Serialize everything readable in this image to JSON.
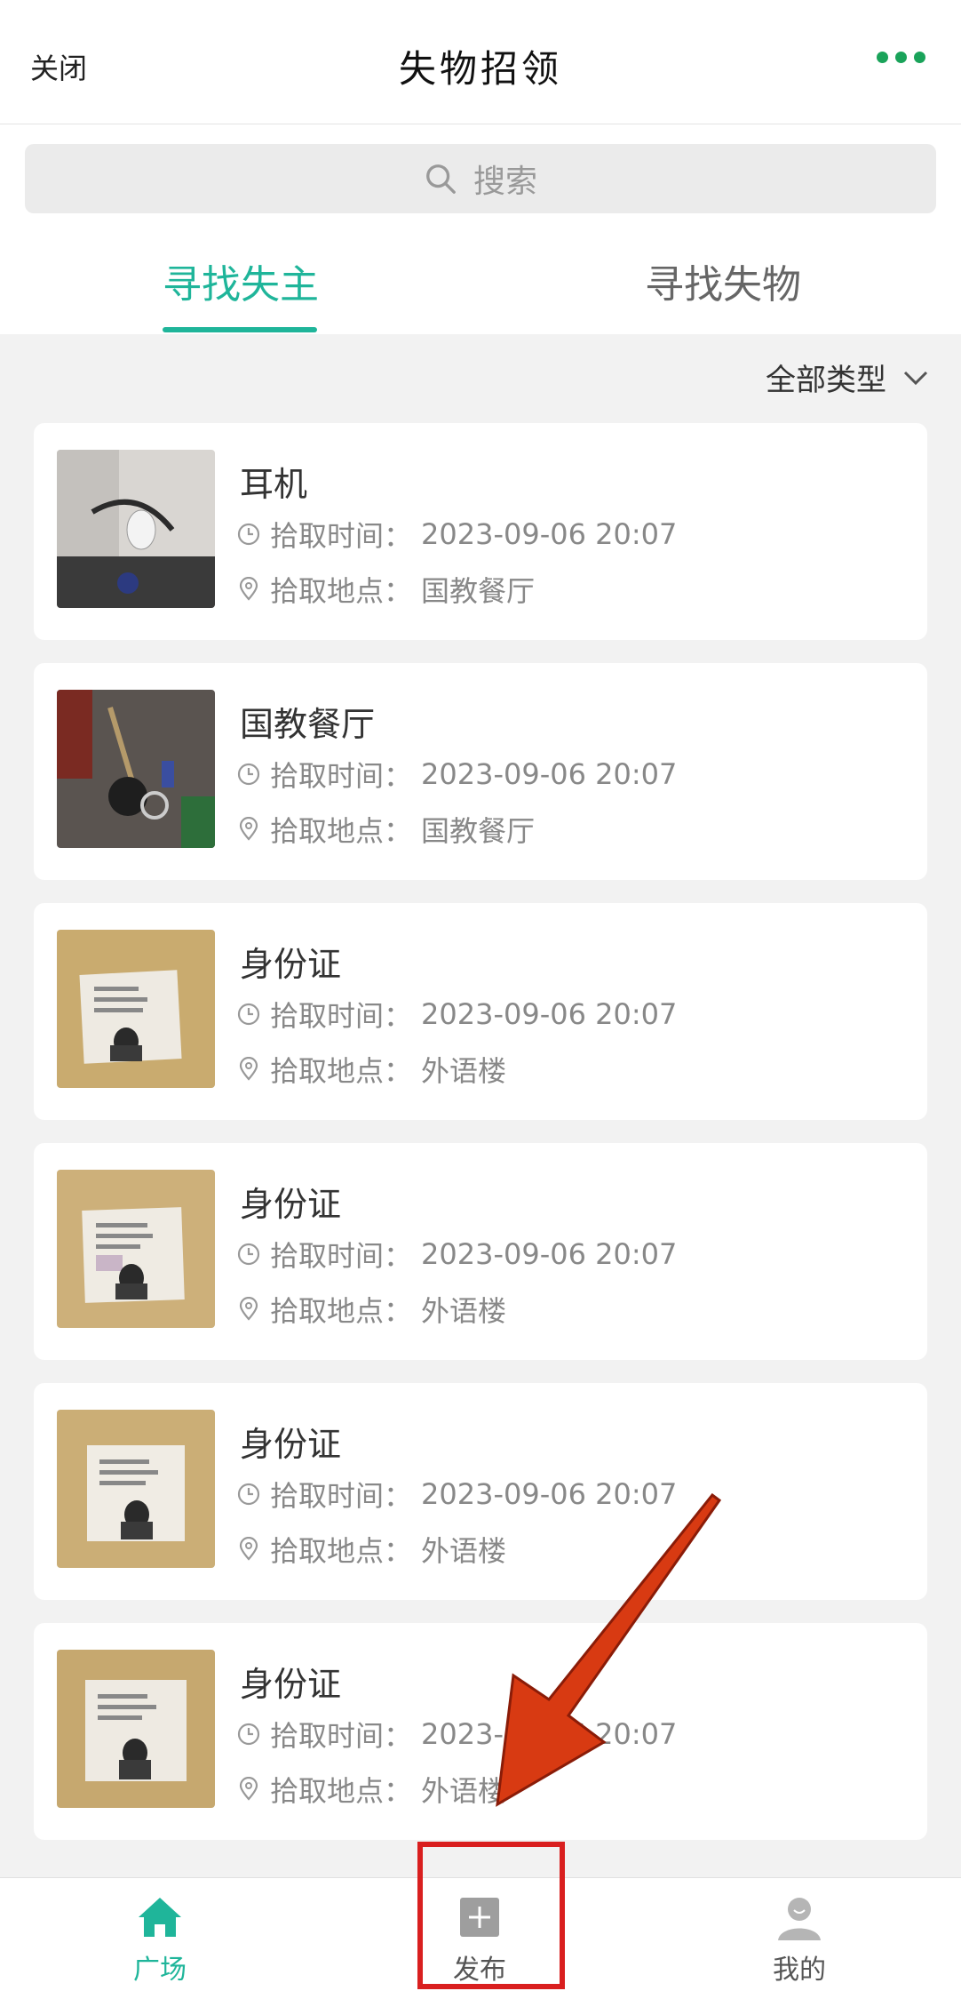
{
  "header": {
    "close_label": "关闭",
    "title": "失物招领",
    "more_icon": "more-dots-icon",
    "accent": "#1aa35a"
  },
  "search": {
    "placeholder": "搜索",
    "icon": "search-icon"
  },
  "tabs": [
    {
      "label": "寻找失主",
      "active": true
    },
    {
      "label": "寻找失物",
      "active": false
    }
  ],
  "filter": {
    "label": "全部类型",
    "icon": "chevron-down-icon"
  },
  "items": [
    {
      "name": "耳机",
      "time_label": "拾取时间：",
      "time": "2023-09-06 20:07",
      "place_label": "拾取地点：",
      "place": "国教餐厅"
    },
    {
      "name": "国教餐厅",
      "time_label": "拾取时间：",
      "time": "2023-09-06 20:07",
      "place_label": "拾取地点：",
      "place": "国教餐厅"
    },
    {
      "name": "身份证",
      "time_label": "拾取时间：",
      "time": "2023-09-06 20:07",
      "place_label": "拾取地点：",
      "place": "外语楼"
    },
    {
      "name": "身份证",
      "time_label": "拾取时间：",
      "time": "2023-09-06 20:07",
      "place_label": "拾取地点：",
      "place": "外语楼"
    },
    {
      "name": "身份证",
      "time_label": "拾取时间：",
      "time": "2023-09-06 20:07",
      "place_label": "拾取地点：",
      "place": "外语楼"
    },
    {
      "name": "身份证",
      "time_label": "拾取时间：",
      "time": "2023-09-06 20:07",
      "place_label": "拾取地点：",
      "place": "外语楼"
    }
  ],
  "bottom_nav": [
    {
      "label": "广场",
      "icon": "home-icon",
      "active": true
    },
    {
      "label": "发布",
      "icon": "plus-square-icon",
      "active": false
    },
    {
      "label": "我的",
      "icon": "user-icon",
      "active": false
    }
  ],
  "colors": {
    "tab_active": "#1fb59a",
    "annotation_box": "#d91f1f",
    "annotation_arrow": "#d83a12"
  }
}
